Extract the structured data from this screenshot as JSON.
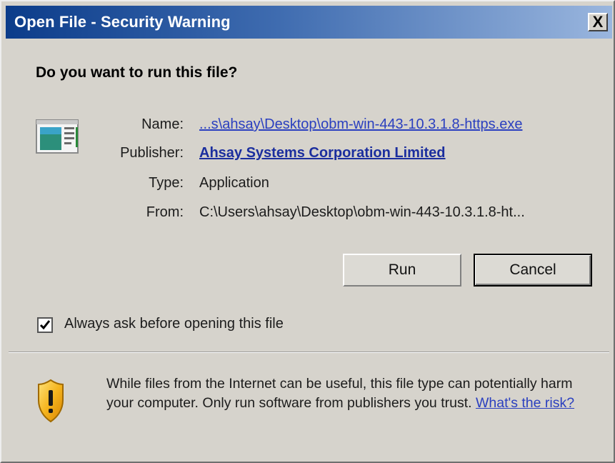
{
  "window": {
    "title": "Open File - Security Warning",
    "close_label": "X"
  },
  "question": "Do you want to run this file?",
  "details": {
    "name_label": "Name:",
    "name_value": "...s\\ahsay\\Desktop\\obm-win-443-10.3.1.8-https.exe",
    "publisher_label": "Publisher:",
    "publisher_value": "Ahsay Systems Corporation Limited",
    "type_label": "Type:",
    "type_value": "Application",
    "from_label": "From:",
    "from_value": "C:\\Users\\ahsay\\Desktop\\obm-win-443-10.3.1.8-ht..."
  },
  "buttons": {
    "run": "Run",
    "cancel": "Cancel"
  },
  "checkbox": {
    "label": "Always ask before opening this file",
    "checked": true
  },
  "warning": {
    "text": "While files from the Internet can be useful, this file type can potentially harm your computer. Only run software from publishers you trust.",
    "link": "What's the risk?"
  },
  "icons": {
    "file": "application-file-icon",
    "shield": "warning-shield-icon",
    "check": "checkmark-icon"
  }
}
